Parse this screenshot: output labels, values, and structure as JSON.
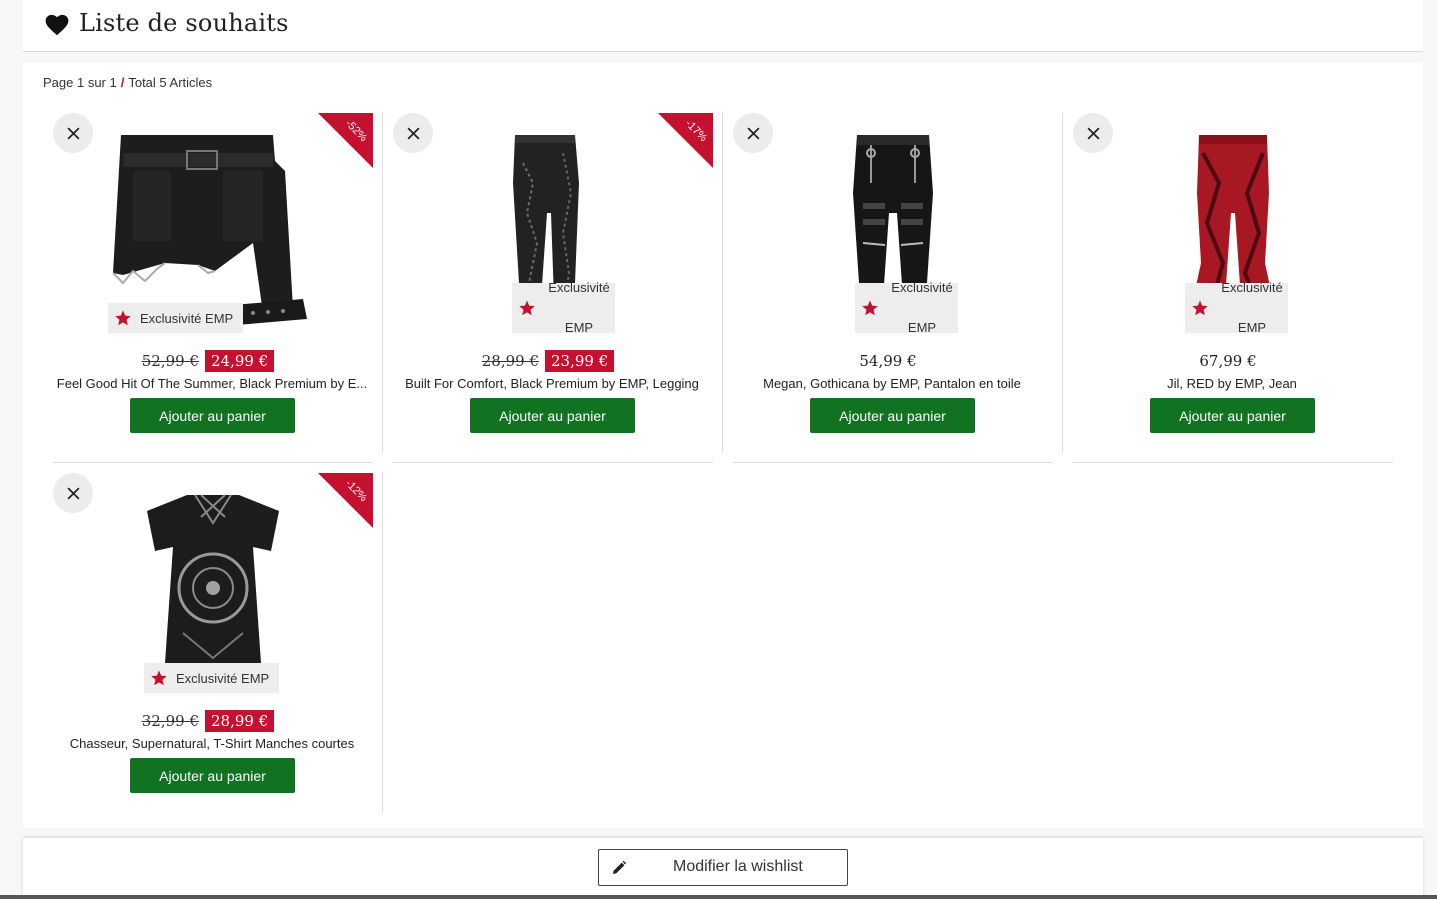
{
  "header": {
    "title": "Liste de souhaits",
    "icon": "heart-icon"
  },
  "pager": {
    "page_text": "Page 1 sur 1",
    "separator": "/",
    "total_text": "Total 5 Articles"
  },
  "colors": {
    "sale_red": "#c4112f",
    "cart_green": "#117322"
  },
  "products": [
    {
      "name": "Feel Good Hit Of The Summer, Black Premium by E...",
      "old_price": "52,99 €",
      "price": "24,99 €",
      "discount": "-52%",
      "exclusive": "Exclusivité EMP",
      "image": "black-denim-shorts"
    },
    {
      "name": "Built For Comfort, Black Premium by EMP, Legging",
      "old_price": "28,99 €",
      "price": "23,99 €",
      "discount": "-17%",
      "exclusive": [
        "Exclusivité",
        "EMP"
      ],
      "image": "black-leggings"
    },
    {
      "name": "Megan, Gothicana by EMP, Pantalon en toile",
      "price": "54,99 €",
      "exclusive": [
        "Exclusivité",
        "EMP"
      ],
      "image": "black-strap-pants"
    },
    {
      "name": "Jil, RED by EMP, Jean",
      "price": "67,99 €",
      "exclusive": [
        "Exclusivité",
        "EMP"
      ],
      "image": "red-flared-jeans"
    },
    {
      "name": "Chasseur, Supernatural, T-Shirt Manches courtes",
      "old_price": "32,99 €",
      "price": "28,99 €",
      "discount": "-12%",
      "exclusive": "Exclusivité EMP",
      "image": "black-tshirt"
    }
  ],
  "actions": {
    "add_to_cart": "Ajouter au panier",
    "edit_wishlist": "Modifier la wishlist"
  }
}
